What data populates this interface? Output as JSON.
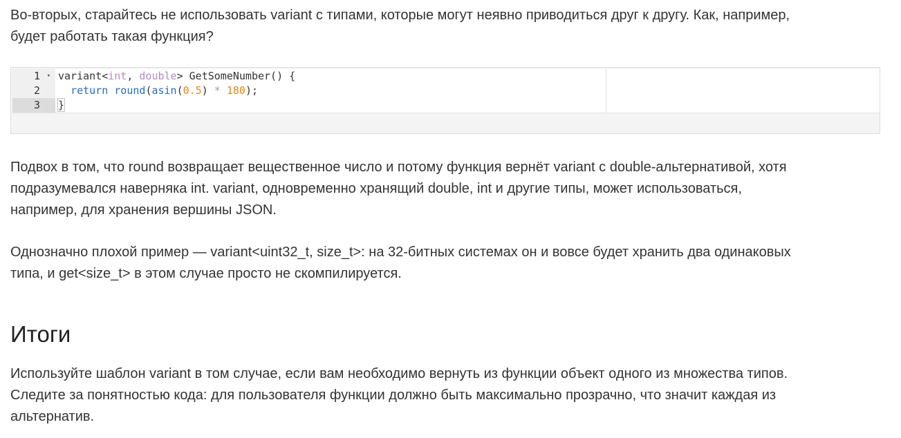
{
  "intro": {
    "lines": [
      "Во-вторых, старайтесь не использовать variant с типами, которые могут неявно приводиться друг к другу. Как, например,",
      "будет работать такая функция?"
    ]
  },
  "code": {
    "line_numbers": [
      "1",
      "2",
      "3"
    ],
    "fold_icon": "▾",
    "lines": [
      {
        "t1": "variant<",
        "t2": "int",
        "t3": ", ",
        "t4": "double",
        "t5": "> GetSomeNumber() ",
        "t6": "{"
      },
      {
        "indent": "  ",
        "t1": "return",
        "t2": " ",
        "t3": "round",
        "t4": "(",
        "t5": "asin",
        "t6": "(",
        "t7": "0.5",
        "t8": ") ",
        "t9": "*",
        "t10": " ",
        "t11": "180",
        "t12": ");"
      },
      {
        "t1": "}"
      }
    ]
  },
  "p1": {
    "lines": [
      "Подвох в том, что round возвращает вещественное число и потому функция вернёт variant с double-альтернативой, хотя",
      "подразумевался наверняка int. variant, одновременно хранящий double, int и другие типы, может использоваться,",
      "например, для хранения вершины JSON."
    ]
  },
  "p2": {
    "lines": [
      "Однозначно плохой пример — variant<uint32_t, size_t>: на 32-битных системах он и вовсе будет хранить два одинаковых",
      "типа, и get<size_t> в этом случае просто не скомпилируется."
    ]
  },
  "heading": "Итоги",
  "p3": {
    "lines": [
      "Используйте шаблон variant в том случае, если вам необходимо вернуть из функции объект одного из множества типов.",
      "Следите за понятностью кода: для пользователя функции должно быть максимально прозрачно, что значит каждая из",
      "альтернатив."
    ]
  }
}
